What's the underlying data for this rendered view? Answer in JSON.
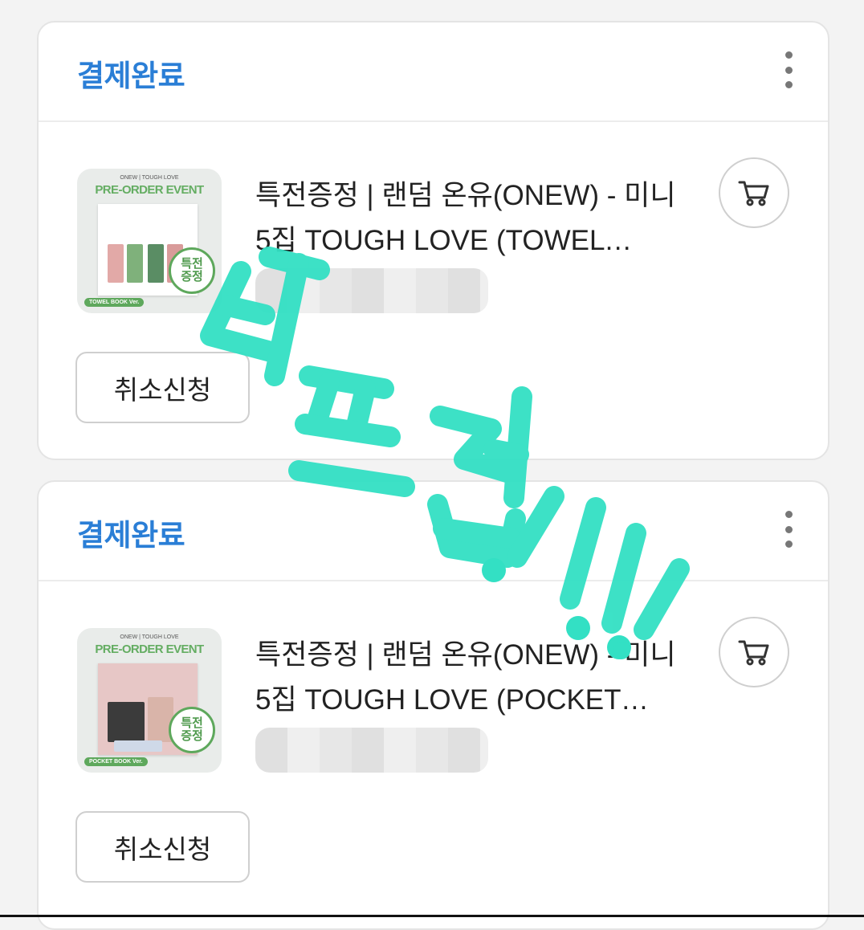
{
  "orders": [
    {
      "status": "결제완료",
      "thumbnail": {
        "brand": "ONEW | TOUGH LOVE",
        "event": "PRE-ORDER EVENT",
        "sticker_line1": "특전",
        "sticker_line2": "증정",
        "version": "TOWEL BOOK Ver."
      },
      "product_title": "특전증정 | 랜덤 온유(ONEW) - 미니5집 TOUGH LOVE (TOWEL BOOK Ver.)",
      "cancel_label": "취소신청"
    },
    {
      "status": "결제완료",
      "thumbnail": {
        "brand": "ONEW | TOUGH LOVE",
        "event": "PRE-ORDER EVENT",
        "sticker_line1": "특전",
        "sticker_line2": "증정",
        "version": "POCKET BOOK Ver."
      },
      "product_title": "특전증정 | 랜덤 온유(ONEW) - 미니5집 TOUGH LOVE (POCKET BOOK Ver.)",
      "cancel_label": "취소신청"
    }
  ],
  "icons": {
    "more": "more-vertical-icon",
    "cart": "cart-icon"
  },
  "colors": {
    "status": "#2a7ed6",
    "watermark": "#33e0c4",
    "brand_green": "#5ea85c"
  },
  "watermark_text": "터프럽!!!!"
}
